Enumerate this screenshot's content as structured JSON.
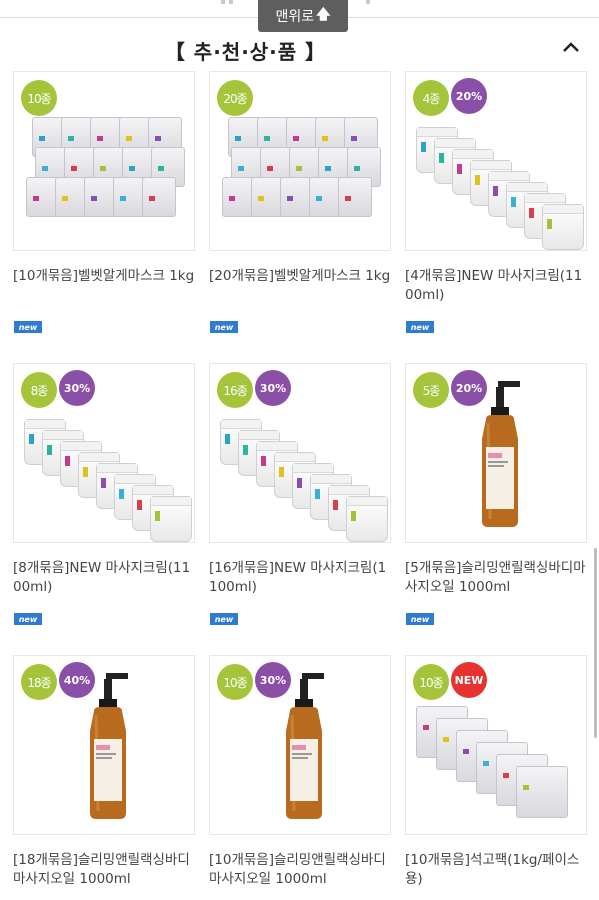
{
  "header": {
    "scroll_top_label": "맨위로",
    "section_title": "【 추·천·상·품 】"
  },
  "colors": {
    "count_badge": "#a6c43a",
    "sale_badge": "#8a4fa6",
    "new_badge": "#e8322f",
    "new_tag": "#2e7bd0"
  },
  "products": [
    {
      "count": "10종",
      "sale": "",
      "image": "velvet-algae-mask-packs",
      "title": "[10개묶음]벨벳알게마스크 1kg",
      "new_tag": "new"
    },
    {
      "count": "20종",
      "sale": "",
      "image": "velvet-algae-mask-packs",
      "title": "[20개묶음]벨벳알게마스크 1kg",
      "new_tag": "new"
    },
    {
      "count": "4종",
      "sale": "20%",
      "image": "massage-cream-jars",
      "title": "[4개묶음]NEW 마사지크림(1100ml)",
      "new_tag": "new"
    },
    {
      "count": "8종",
      "sale": "30%",
      "image": "massage-cream-jars",
      "title": "[8개묶음]NEW 마사지크림(1100ml)",
      "new_tag": "new"
    },
    {
      "count": "16종",
      "sale": "30%",
      "image": "massage-cream-jars",
      "title": "[16개묶음]NEW 마사지크림(1100ml)",
      "new_tag": "new"
    },
    {
      "count": "5종",
      "sale": "20%",
      "image": "body-oil-bottle",
      "title": "[5개묶음]슬리밍앤릴랙싱바디마사지오일 1000ml",
      "new_tag": "new"
    },
    {
      "count": "18종",
      "sale": "40%",
      "image": "body-oil-bottle",
      "title": "[18개묶음]슬리밍앤릴랙싱바디마사지오일 1000ml",
      "new_tag": ""
    },
    {
      "count": "10종",
      "sale": "30%",
      "image": "body-oil-bottle",
      "title": "[10개묶음]슬리밍앤릴랙싱바디마사지오일 1000ml",
      "new_tag": ""
    },
    {
      "count": "10종",
      "sale": "NEW",
      "image": "plaster-pack-bags",
      "title": "[10개묶음]석고팩(1kg/페이스용)",
      "new_tag": ""
    }
  ]
}
